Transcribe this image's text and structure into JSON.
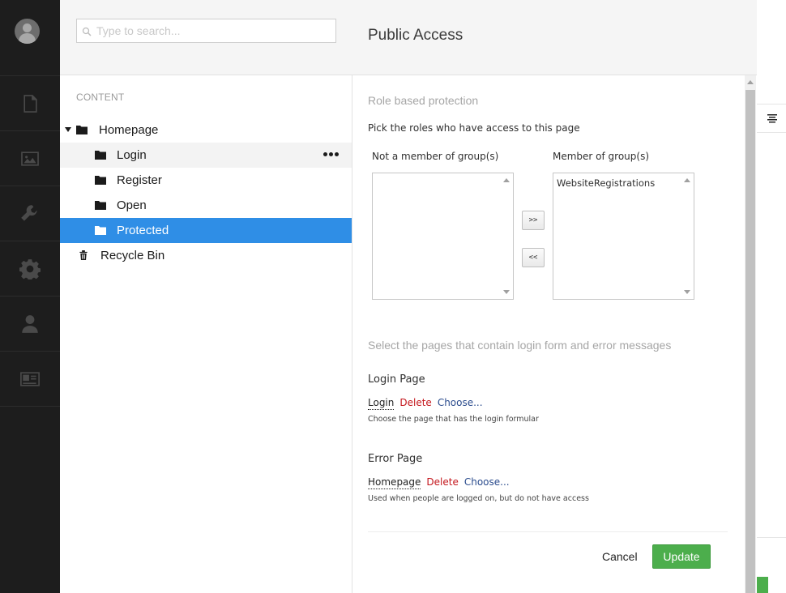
{
  "search": {
    "placeholder": "Type to search..."
  },
  "tree": {
    "section_label": "CONTENT",
    "nodes": [
      {
        "label": "Homepage"
      },
      {
        "label": "Login"
      },
      {
        "label": "Register"
      },
      {
        "label": "Open"
      },
      {
        "label": "Protected"
      },
      {
        "label": "Recycle Bin"
      }
    ]
  },
  "dialog": {
    "title": "Public Access",
    "role_section_title": "Role based protection",
    "role_instructions": "Pick the roles who have access to this page",
    "not_member_label": "Not a member of group(s)",
    "member_label": "Member of group(s)",
    "not_member_items": [],
    "member_items": [
      "WebsiteRegistrations"
    ],
    "add_button": ">>",
    "remove_button": "<<",
    "pages_section_title": "Select the pages that contain login form and error messages",
    "login_page": {
      "label": "Login Page",
      "value": "Login",
      "delete": "Delete",
      "choose": "Choose...",
      "help": "Choose the page that has the login formular"
    },
    "error_page": {
      "label": "Error Page",
      "value": "Homepage",
      "delete": "Delete",
      "choose": "Choose...",
      "help": "Used when people are logged on, but do not have access"
    },
    "cancel": "Cancel",
    "update": "Update"
  },
  "colors": {
    "accent": "#2f8ee6",
    "success": "#4cae4c",
    "danger": "#c4161c",
    "link": "#2a4b8d",
    "rail": "#1d1d1d"
  },
  "icons": [
    "user-avatar-icon",
    "document-icon",
    "image-icon",
    "wrench-icon",
    "gear-icon",
    "user-icon",
    "id-card-icon",
    "search-icon",
    "folder-icon",
    "trash-icon",
    "more-icon",
    "align-icon"
  ]
}
